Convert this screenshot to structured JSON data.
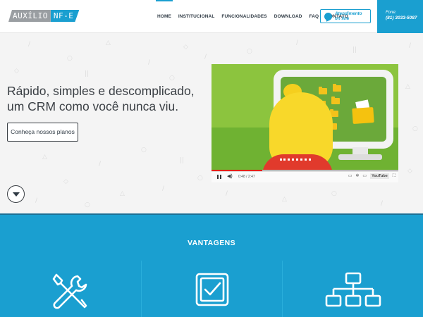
{
  "logo": {
    "part1": "AUXÍLIO",
    "part2": "NF-E"
  },
  "nav": {
    "items": [
      {
        "label": "HOME",
        "active": true
      },
      {
        "label": "INSTITUCIONAL",
        "active": false
      },
      {
        "label": "FUNCIONALIDADES",
        "active": false
      },
      {
        "label": "DOWNLOAD",
        "active": false
      },
      {
        "label": "FAQ",
        "active": false
      },
      {
        "label": "CONTATO",
        "active": false
      }
    ]
  },
  "chat": {
    "line1": "Atendimento",
    "line2": "on line",
    "icon": "chat-bubble-icon"
  },
  "phone": {
    "label": "Fone:",
    "number": "(81) 3033-5087"
  },
  "hero": {
    "title_line1": "Rápido, simples e descomplicado,",
    "title_line2": "um CRM como você nunca viu.",
    "plans_button": "Conheça nossos planos",
    "scroll_icon": "chevron-down-icon"
  },
  "video": {
    "time": "0:48 / 2:47",
    "progress": 0.27,
    "brand": "YouTube"
  },
  "vantagens": {
    "title": "VANTAGENS",
    "icons": [
      "tools-icon",
      "checkbox-icon",
      "hierarchy-icon"
    ]
  },
  "colors": {
    "accent": "#1a9fd0",
    "text_dark": "#2f3a44",
    "logo_gray": "#9a9ea2"
  }
}
